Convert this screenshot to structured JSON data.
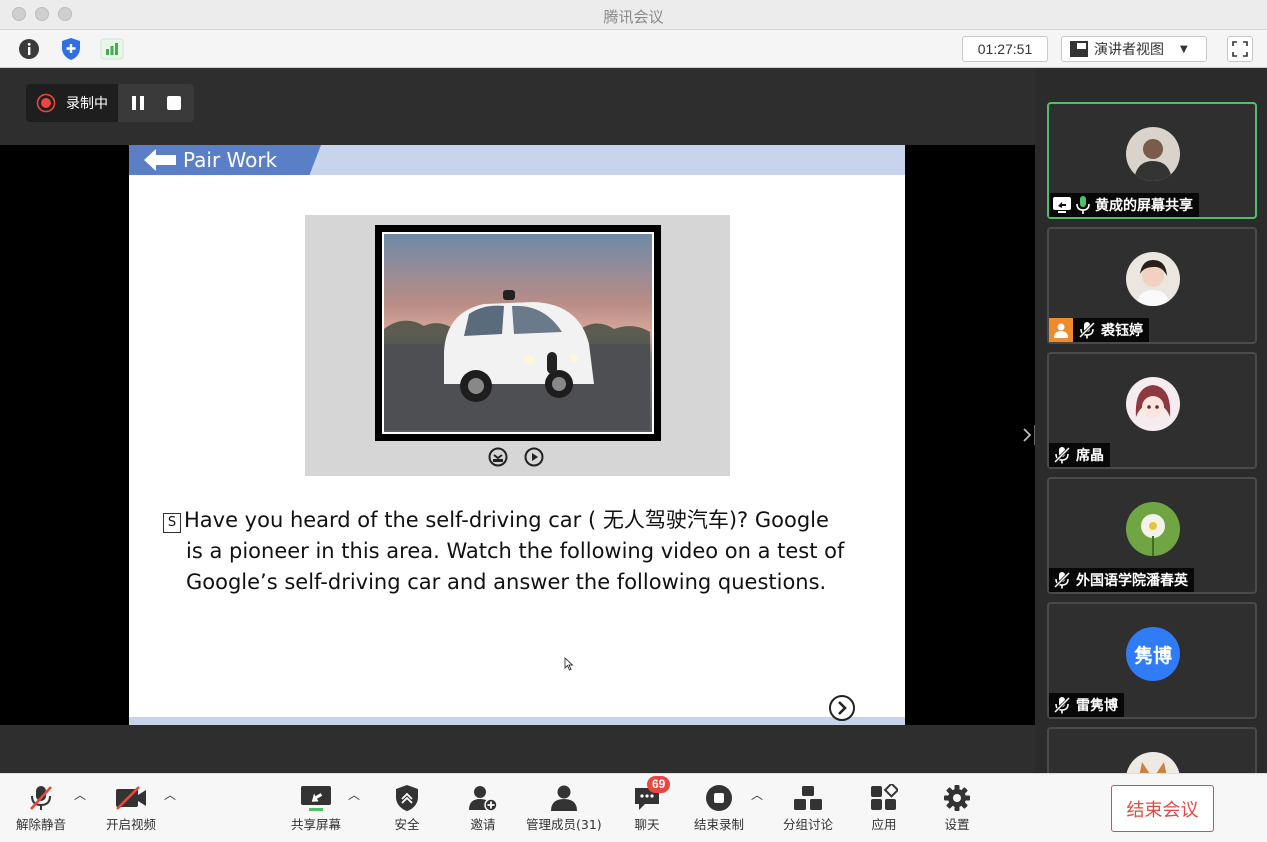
{
  "window": {
    "title": "腾讯会议"
  },
  "toolbar": {
    "timer": "01:27:51",
    "view_label": "演讲者视图",
    "icons": [
      "info-icon",
      "shield-icon",
      "signal-icon",
      "fullscreen-icon"
    ]
  },
  "recording": {
    "status_label": "录制中"
  },
  "slide": {
    "header_title": "Pair Work",
    "question_prefix": "S",
    "text_line1_a": "Have you heard of the self-driving car ( ",
    "text_line1_cn": "无人驾驶汽车",
    "text_line1_b": ")? Google",
    "text_line2": "is a pioneer in this area. Watch the following video on a test of",
    "text_line3": "Google’s self-driving car and answer the following questions."
  },
  "participants": [
    {
      "name": "黄成的屏幕共享",
      "status": "sharing",
      "active": true
    },
    {
      "name": "裘钰婷",
      "status": "muted"
    },
    {
      "name": "席晶",
      "status": "muted"
    },
    {
      "name": "外国语学院潘春英",
      "status": "muted"
    },
    {
      "name": "雷隽博",
      "status": "muted",
      "avatar_text": "隽博",
      "avatar_color": "#2f7cf6"
    }
  ],
  "bottombar": {
    "unmute": "解除静音",
    "video": "开启视频",
    "share": "共享屏幕",
    "security": "安全",
    "invite": "邀请",
    "members": "管理成员(31)",
    "chat": "聊天",
    "chat_badge": "69",
    "stop_record": "结束录制",
    "breakout": "分组讨论",
    "apps": "应用",
    "settings": "设置",
    "end_meeting": "结束会议"
  },
  "colors": {
    "accent_green": "#4fc06a",
    "end_red": "#e04a44",
    "avatar_blue": "#2f7cf6",
    "slide_blue": "#5b7fc7"
  }
}
